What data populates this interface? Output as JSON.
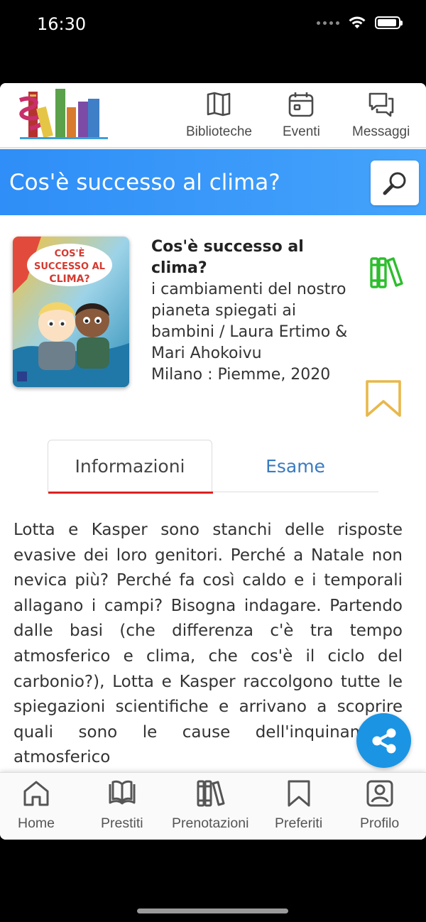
{
  "status_bar": {
    "time": "16:30"
  },
  "top_nav": {
    "items": [
      {
        "label": "Biblioteche",
        "icon": "library-book-icon"
      },
      {
        "label": "Eventi",
        "icon": "calendar-icon"
      },
      {
        "label": "Messaggi",
        "icon": "chat-icon"
      }
    ]
  },
  "title_bar": {
    "title": "Cos'è successo al clima?",
    "search_icon": "search-icon"
  },
  "book": {
    "title_line": "Cos'è successo al clima?",
    "subtitle": "i cambiamenti del nostro pianeta spiegati ai bambini / Laura Ertimo & Mari Ahokoivu",
    "publication": "Milano : Piemme, 2020",
    "cover_text": "COS'È SUCCESSO AL CLIMA?",
    "actions": {
      "reserve_icon": "books-icon",
      "reserve_color": "#2ebd2e",
      "favorite_icon": "bookmark-icon",
      "favorite_color": "#e8b84a"
    }
  },
  "tabs": [
    {
      "label": "Informazioni",
      "active": true
    },
    {
      "label": "Esame",
      "active": false
    }
  ],
  "description": "Lotta e Kasper sono stanchi delle risposte evasive dei loro genitori. Perché a Natale non nevica più? Perché fa così caldo e i temporali allagano i campi? Bisogna indagare. Partendo dalle basi (che differenza c'è tra tempo atmosferico e clima, che cos'è il ciclo del carbonio?), Lotta e Kasper raccolgono tutte le spiegazioni scientifiche e arrivano a scoprire quali sono le cause dell'inquinamento atmosferico",
  "share": {
    "icon": "share-icon",
    "color": "#1b94e4"
  },
  "bottom_nav": {
    "items": [
      {
        "label": "Home",
        "icon": "home-icon"
      },
      {
        "label": "Prestiti",
        "icon": "book-open-icon"
      },
      {
        "label": "Prenotazioni",
        "icon": "books-icon"
      },
      {
        "label": "Preferiti",
        "icon": "bookmark-icon"
      },
      {
        "label": "Profilo",
        "icon": "user-icon"
      }
    ]
  },
  "colors": {
    "accent_blue": "#2f8ef7",
    "tab_active_underline": "#dd2222",
    "tab_inactive_text": "#3a7bbf"
  }
}
